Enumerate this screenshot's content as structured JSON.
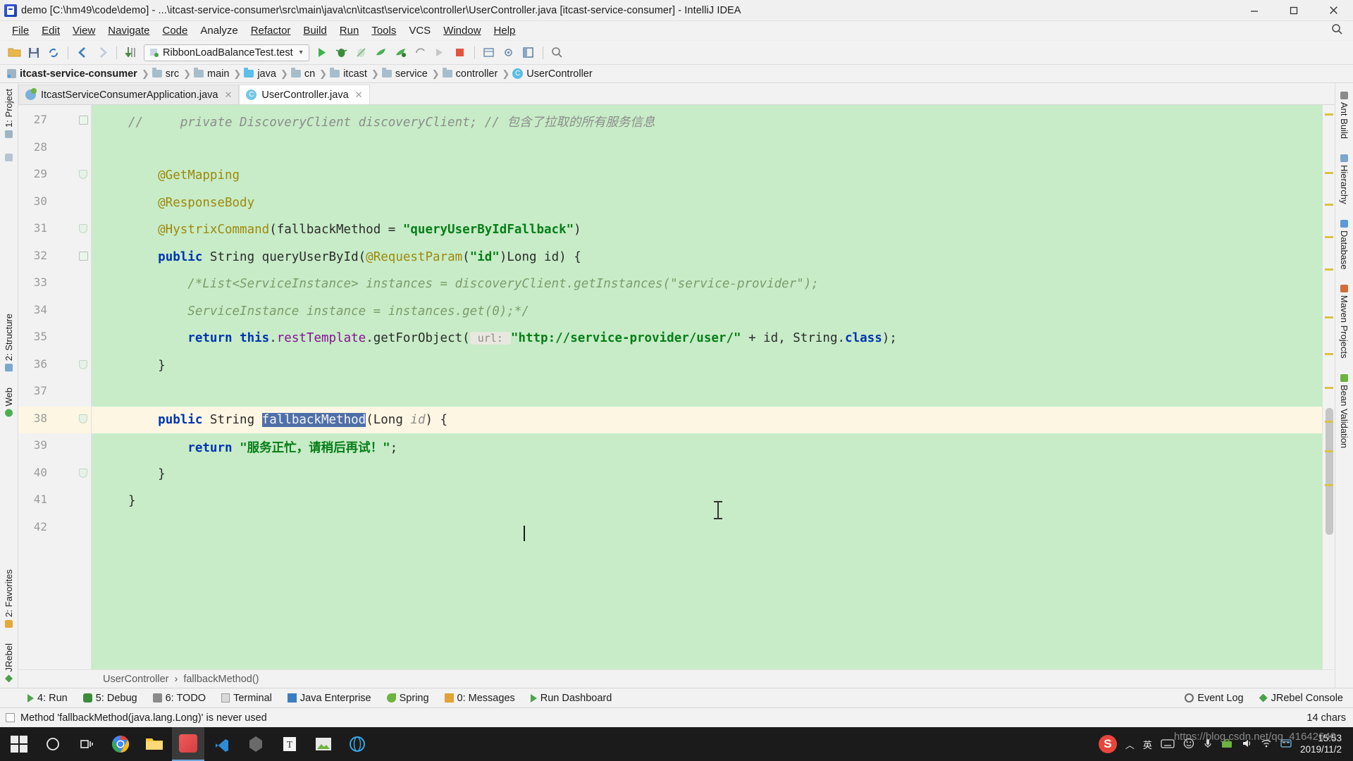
{
  "window": {
    "title": "demo [C:\\hm49\\code\\demo] - ...\\itcast-service-consumer\\src\\main\\java\\cn\\itcast\\service\\controller\\UserController.java [itcast-service-consumer] - IntelliJ IDEA",
    "app_icon": "intellij-idea-icon",
    "minimize": "minimize-icon",
    "maximize": "maximize-icon",
    "close": "close-icon"
  },
  "menubar": {
    "items": [
      {
        "label": "File",
        "mnemonic": "F"
      },
      {
        "label": "Edit",
        "mnemonic": "E"
      },
      {
        "label": "View",
        "mnemonic": "V"
      },
      {
        "label": "Navigate",
        "mnemonic": "N"
      },
      {
        "label": "Code",
        "mnemonic": "C"
      },
      {
        "label": "Analyze",
        "mnemonic": "z"
      },
      {
        "label": "Refactor",
        "mnemonic": "R"
      },
      {
        "label": "Build",
        "mnemonic": "B"
      },
      {
        "label": "Run",
        "mnemonic": "u"
      },
      {
        "label": "Tools",
        "mnemonic": "T"
      },
      {
        "label": "VCS",
        "mnemonic": ""
      },
      {
        "label": "Window",
        "mnemonic": "W"
      },
      {
        "label": "Help",
        "mnemonic": "H"
      }
    ],
    "search_icon": "search-everywhere-icon"
  },
  "toolbar": {
    "buttons": [
      "open-project-icon",
      "save-all-icon",
      "sync-icon",
      "back-icon",
      "forward-icon",
      "compile-icon"
    ],
    "run_config": {
      "label": "RibbonLoadBalanceTest.test",
      "icon": "test-config-icon",
      "chevron": "chevron-down-icon"
    },
    "right_buttons": [
      "run-icon",
      "debug-icon",
      "run-coverage-icon",
      "profile-icon",
      "attach-debugger-icon",
      "rerun-icon",
      "step-icon",
      "stop-icon",
      "project-structure-icon",
      "settings-icon",
      "search-icon"
    ]
  },
  "breadcrumb": {
    "items": [
      {
        "label": "itcast-service-consumer",
        "icon": "module-icon"
      },
      {
        "label": "src",
        "icon": "folder-icon"
      },
      {
        "label": "main",
        "icon": "folder-icon"
      },
      {
        "label": "java",
        "icon": "source-folder-icon"
      },
      {
        "label": "cn",
        "icon": "package-icon"
      },
      {
        "label": "itcast",
        "icon": "package-icon"
      },
      {
        "label": "service",
        "icon": "package-icon"
      },
      {
        "label": "controller",
        "icon": "package-icon"
      },
      {
        "label": "UserController",
        "icon": "class-icon"
      }
    ]
  },
  "editor_tabs": [
    {
      "label": "ItcastServiceConsumerApplication.java",
      "icon": "spring-boot-class-icon",
      "active": false,
      "close": "close-tab-icon"
    },
    {
      "label": "UserController.java",
      "icon": "spring-controller-class-icon",
      "active": true,
      "close": "close-tab-icon"
    }
  ],
  "left_tool_strip": {
    "top": [
      {
        "label": "1: Project",
        "icon": "project-icon"
      },
      {
        "label": "",
        "icon": "commander-icon"
      }
    ],
    "middle": [
      {
        "label": "2: Structure",
        "icon": "structure-icon"
      },
      {
        "label": "Web",
        "icon": "web-icon"
      }
    ],
    "bottom": [
      {
        "label": "2: Favorites",
        "icon": "favorites-icon"
      },
      {
        "label": "JRebel",
        "icon": "jrebel-icon"
      }
    ]
  },
  "right_tool_strip": {
    "items": [
      {
        "label": "Ant Build",
        "icon": "ant-icon"
      },
      {
        "label": "Hierarchy",
        "icon": "hierarchy-icon"
      },
      {
        "label": "Database",
        "icon": "database-icon"
      },
      {
        "label": "Maven Projects",
        "icon": "maven-icon"
      },
      {
        "label": "Bean Validation",
        "icon": "bean-validation-icon"
      }
    ]
  },
  "code": {
    "first_line_number": 27,
    "lines": [
      {
        "n": 27,
        "fold": "plus",
        "highlight": false,
        "tokens": [
          {
            "t": "//     ",
            "c": "cm"
          },
          {
            "t": "private DiscoveryClient discoveryClient; // 包含了拉取的所有服务信息",
            "c": "cm"
          }
        ]
      },
      {
        "n": 28,
        "fold": "",
        "highlight": false,
        "tokens": []
      },
      {
        "n": 29,
        "fold": "shield",
        "highlight": false,
        "tokens": [
          {
            "t": "    @GetMapping",
            "c": "ann"
          }
        ]
      },
      {
        "n": 30,
        "fold": "",
        "highlight": false,
        "tokens": [
          {
            "t": "    @ResponseBody",
            "c": "ann"
          }
        ]
      },
      {
        "n": 31,
        "fold": "shield",
        "highlight": false,
        "tokens": [
          {
            "t": "    @HystrixCommand",
            "c": "ann"
          },
          {
            "t": "(fallbackMethod = ",
            "c": "txtd"
          },
          {
            "t": "\"queryUserByIdFallback\"",
            "c": "str"
          },
          {
            "t": ")",
            "c": "txtd"
          }
        ]
      },
      {
        "n": 32,
        "fold": "plus",
        "highlight": false,
        "tokens": [
          {
            "t": "    ",
            "c": "txtd"
          },
          {
            "t": "public",
            "c": "kw"
          },
          {
            "t": " String queryUserById(",
            "c": "txtd"
          },
          {
            "t": "@RequestParam",
            "c": "ann"
          },
          {
            "t": "(",
            "c": "txtd"
          },
          {
            "t": "\"id\"",
            "c": "str"
          },
          {
            "t": ")Long id) {",
            "c": "txtd"
          }
        ]
      },
      {
        "n": 33,
        "fold": "",
        "highlight": false,
        "tokens": [
          {
            "t": "        /*List<ServiceInstance> instances = discoveryClient.getInstances(\"service-provider\");",
            "c": "cmg"
          }
        ]
      },
      {
        "n": 34,
        "fold": "",
        "highlight": false,
        "tokens": [
          {
            "t": "        ServiceInstance instance = instances.get(0);*/",
            "c": "cmg"
          }
        ]
      },
      {
        "n": 35,
        "fold": "",
        "highlight": false,
        "tokens": [
          {
            "t": "        ",
            "c": "txtd"
          },
          {
            "t": "return",
            "c": "kw"
          },
          {
            "t": " ",
            "c": "txtd"
          },
          {
            "t": "this",
            "c": "kw"
          },
          {
            "t": ".",
            "c": "txtd"
          },
          {
            "t": "restTemplate",
            "c": "fld"
          },
          {
            "t": ".getForObject(",
            "c": "txtd"
          },
          {
            "t": " url: ",
            "c": "hint"
          },
          {
            "t": "\"http://service-provider/user/\"",
            "c": "str"
          },
          {
            "t": " + id, String.",
            "c": "txtd"
          },
          {
            "t": "class",
            "c": "kw"
          },
          {
            "t": ");",
            "c": "txtd"
          }
        ]
      },
      {
        "n": 36,
        "fold": "shield",
        "highlight": false,
        "tokens": [
          {
            "t": "    }",
            "c": "txtd"
          }
        ]
      },
      {
        "n": 37,
        "fold": "",
        "highlight": false,
        "tokens": []
      },
      {
        "n": 38,
        "fold": "shield",
        "highlight": true,
        "tokens": [
          {
            "t": "    ",
            "c": "txtd"
          },
          {
            "t": "public",
            "c": "kw"
          },
          {
            "t": " String ",
            "c": "txtd"
          },
          {
            "t": "fallbackMethod",
            "c": "sel"
          },
          {
            "t": "(Long ",
            "c": "txtd"
          },
          {
            "t": "id",
            "c": "cm"
          },
          {
            "t": ") {",
            "c": "txtd"
          }
        ]
      },
      {
        "n": 39,
        "fold": "",
        "highlight": false,
        "tokens": [
          {
            "t": "        ",
            "c": "txtd"
          },
          {
            "t": "return",
            "c": "kw"
          },
          {
            "t": " ",
            "c": "txtd"
          },
          {
            "t": "\"服务正忙，请稍后再试！\"",
            "c": "str"
          },
          {
            "t": ";",
            "c": "txtd"
          }
        ]
      },
      {
        "n": 40,
        "fold": "shield",
        "highlight": false,
        "tokens": [
          {
            "t": "    }",
            "c": "txtd"
          }
        ]
      },
      {
        "n": 41,
        "fold": "",
        "highlight": false,
        "tokens": [
          {
            "t": "}",
            "c": "txtd"
          }
        ]
      },
      {
        "n": 42,
        "fold": "",
        "highlight": false,
        "tokens": []
      }
    ],
    "selection_text": "fallbackMethod",
    "colors": {
      "background": "#c7ecc7",
      "current_line": "#fdf6e3",
      "selection": "#4f6fa8",
      "keyword": "#0033b3",
      "string": "#067d17",
      "comment": "#8c8c8c",
      "annotation": "#9e880d",
      "field": "#871094"
    }
  },
  "editor_breadcrumb": {
    "items": [
      "UserController",
      "fallbackMethod()"
    ],
    "separator": "›"
  },
  "tool_windows": {
    "items": [
      {
        "label": "4: Run",
        "mnemonic": "4",
        "icon": "run-icon"
      },
      {
        "label": "5: Debug",
        "mnemonic": "5",
        "icon": "debug-icon"
      },
      {
        "label": "6: TODO",
        "mnemonic": "6",
        "icon": "todo-icon"
      },
      {
        "label": "Terminal",
        "mnemonic": "",
        "icon": "terminal-icon"
      },
      {
        "label": "Java Enterprise",
        "mnemonic": "",
        "icon": "java-enterprise-icon"
      },
      {
        "label": "Spring",
        "mnemonic": "",
        "icon": "spring-icon"
      },
      {
        "label": "0: Messages",
        "mnemonic": "0",
        "icon": "messages-icon"
      },
      {
        "label": "Run Dashboard",
        "mnemonic": "",
        "icon": "run-dashboard-icon"
      }
    ],
    "right_items": [
      {
        "label": "Event Log",
        "icon": "event-log-icon"
      },
      {
        "label": "JRebel Console",
        "icon": "jrebel-icon"
      }
    ]
  },
  "statusbar": {
    "message": "Method 'fallbackMethod(java.lang.Long)' is never used",
    "chars": "14 chars",
    "checkbox": "hide-warning-checkbox"
  },
  "taskbar": {
    "start": "windows-start-icon",
    "apps": [
      {
        "name": "cortana-search-icon",
        "color": "#1b1b1b"
      },
      {
        "name": "task-view-icon",
        "color": "#1b1b1b"
      },
      {
        "name": "google-chrome-icon",
        "color": "#4285f4"
      },
      {
        "name": "file-explorer-icon",
        "color": "#ffc83d"
      },
      {
        "name": "intellij-idea-icon",
        "color": "#f05a5a"
      },
      {
        "name": "visual-studio-code-icon",
        "color": "#2d8cd6"
      },
      {
        "name": "git-bash-icon",
        "color": "#6a6a6a"
      },
      {
        "name": "typora-icon",
        "color": "#f4f4f4"
      },
      {
        "name": "image-viewer-icon",
        "color": "#6cb33f"
      },
      {
        "name": "browser-icon",
        "color": "#37a7e8"
      }
    ],
    "tray": {
      "sogou_ime": "S",
      "language": "英",
      "show_hidden": "chevron-up-icon",
      "items": [
        "sogou-icon",
        "language-icon",
        "keyboard-icon",
        "emoji-icon",
        "mic-icon",
        "toolbox-icon",
        "volume-icon",
        "network-icon",
        "input-method-icon"
      ],
      "time": "15:53",
      "date": "2019/11/2"
    }
  },
  "watermark": "https://blog.csdn.net/qq_41642640"
}
